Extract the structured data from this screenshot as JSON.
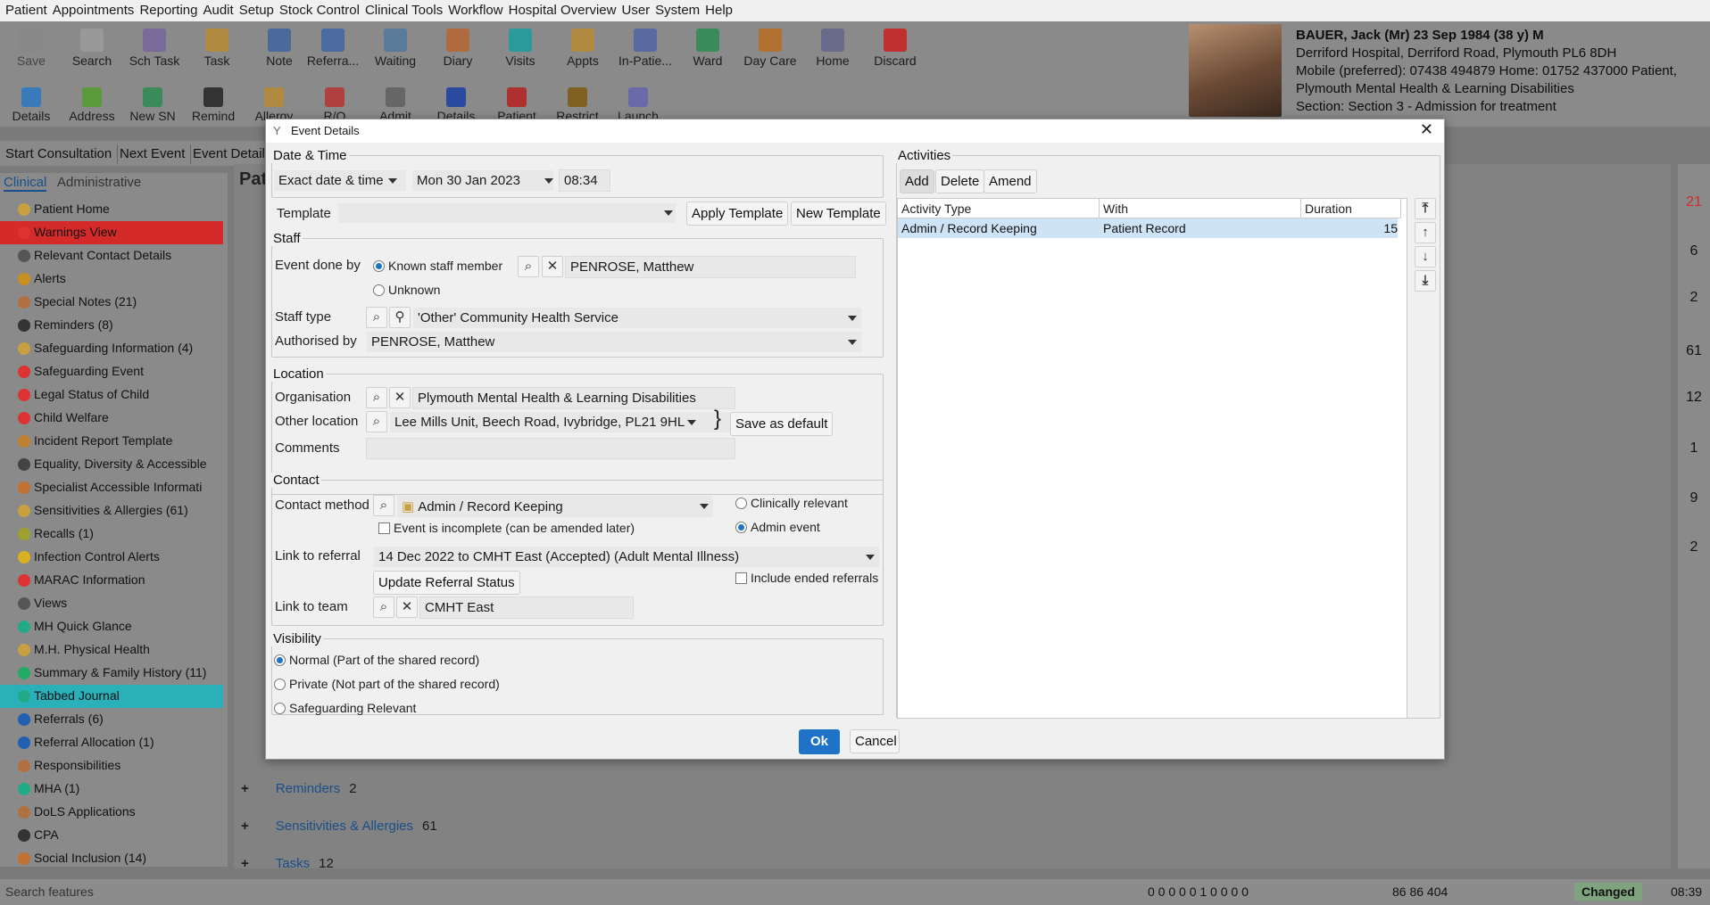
{
  "menu": [
    "Patient",
    "Appointments",
    "Reporting",
    "Audit",
    "Setup",
    "Stock Control",
    "Clinical Tools",
    "Workflow",
    "Hospital Overview",
    "User",
    "System",
    "Help"
  ],
  "toolbar_row1": [
    "Save",
    "Search",
    "Sch Task",
    "Task",
    "Note",
    "Referra...",
    "Waiting",
    "Diary",
    "Visits",
    "Appts",
    "In-Patie...",
    "Ward",
    "Day Care",
    "Home",
    "Discard"
  ],
  "toolbar_row2": [
    "Details",
    "Address",
    "New SN",
    "Remind",
    "Allergy",
    "R/O",
    "Admit",
    "Details",
    "Patient",
    "Restrict",
    "Launch"
  ],
  "patient": {
    "name_line": "BAUER, Jack (Mr) 23 Sep 1984 (38 y) M",
    "address": "Derriford Hospital, Derriford Road, Plymouth PL6 8DH",
    "phones": "Mobile (preferred): 07438 494879 Home: 01752 437000   Patient,",
    "org": "Plymouth Mental Health & Learning Disabilities",
    "section": "Section: Section 3 - Admission for treatment"
  },
  "nav_buttons": [
    "Start Consultation",
    "Next Event",
    "Event Details"
  ],
  "sidebar": {
    "tabs": [
      "Clinical",
      "Administrative"
    ],
    "items": [
      {
        "label": "Patient Home",
        "color": "#c8a040"
      },
      {
        "label": "Warnings View",
        "color": "#d33"
      },
      {
        "label": "Relevant Contact Details",
        "color": "#555"
      },
      {
        "label": "Alerts",
        "color": "#c89020"
      },
      {
        "label": "Special Notes (21)",
        "color": "#b07040"
      },
      {
        "label": "Reminders (8)",
        "color": "#333"
      },
      {
        "label": "Safeguarding Information (4)",
        "color": "#c8a040"
      },
      {
        "label": "Safeguarding Event",
        "color": "#d33"
      },
      {
        "label": "Legal Status of Child",
        "color": "#d33"
      },
      {
        "label": "Child Welfare",
        "color": "#d33"
      },
      {
        "label": "Incident Report Template",
        "color": "#c08030"
      },
      {
        "label": "Equality, Diversity & Accessible",
        "color": "#444"
      },
      {
        "label": "Specialist Accessible Informati",
        "color": "#c07030"
      },
      {
        "label": "Sensitivities & Allergies (61)",
        "color": "#c8a040"
      },
      {
        "label": "Recalls (1)",
        "color": "#a0a030"
      },
      {
        "label": "Infection Control Alerts",
        "color": "#d8b020"
      },
      {
        "label": "MARAC Information",
        "color": "#d33"
      },
      {
        "label": "Views",
        "color": "#555"
      },
      {
        "label": "MH Quick Glance",
        "color": "#2a8"
      },
      {
        "label": "M.H. Physical Health",
        "color": "#c8a040"
      },
      {
        "label": "Summary & Family History (11)",
        "color": "#2a6"
      },
      {
        "label": "Tabbed Journal",
        "color": "#2a8"
      },
      {
        "label": "Referrals (6)",
        "color": "#2060b0"
      },
      {
        "label": "Referral Allocation (1)",
        "color": "#2060b0"
      },
      {
        "label": "Responsibilities",
        "color": "#b07040"
      },
      {
        "label": "MHA (1)",
        "color": "#2a8"
      },
      {
        "label": "DoLS Applications",
        "color": "#b07040"
      },
      {
        "label": "CPA",
        "color": "#333"
      },
      {
        "label": "Social Inclusion (14)",
        "color": "#c07030"
      }
    ]
  },
  "journal_rows": [
    {
      "label": "Reminders",
      "count": "2"
    },
    {
      "label": "Sensitivities & Allergies",
      "count": "61"
    },
    {
      "label": "Tasks",
      "count": "12"
    }
  ],
  "right_badges": [
    "21",
    "6",
    "2",
    "61",
    "12",
    "1",
    "9",
    "2"
  ],
  "status": {
    "search_placeholder": "Search features",
    "counts": "0  0  0  0  0  1  0  0  0  0",
    "numbers": "86  86  404",
    "changed": "Changed",
    "time": "08:39"
  },
  "dialog": {
    "title": "Event Details",
    "datetime": {
      "group": "Date & Time",
      "mode": "Exact date & time",
      "date": "Mon 30 Jan 2023",
      "time": "08:34"
    },
    "template": {
      "label": "Template",
      "value": "",
      "apply": "Apply Template",
      "new": "New Template"
    },
    "staff": {
      "group": "Staff",
      "done_by_label": "Event done by",
      "known": "Known staff member",
      "unknown": "Unknown",
      "staff_name": "PENROSE, Matthew",
      "staff_type_label": "Staff type",
      "staff_type": "'Other' Community Health Service",
      "authorised_label": "Authorised by",
      "authorised": "PENROSE, Matthew"
    },
    "location": {
      "group": "Location",
      "org_label": "Organisation",
      "org": "Plymouth Mental Health & Learning Disabilities",
      "other_label": "Other location",
      "other": "Lee Mills Unit, Beech Road, Ivybridge, PL21 9HL",
      "save_default": "Save as default",
      "comments_label": "Comments",
      "comments": ""
    },
    "contact": {
      "group": "Contact",
      "method_label": "Contact method",
      "method": "Admin / Record Keeping",
      "clinically": "Clinically relevant",
      "admin": "Admin event",
      "incomplete": "Event is incomplete (can be amended later)",
      "referral_label": "Link to referral",
      "referral": "14 Dec 2022 to CMHT East (Accepted)  (Adult Mental Illness)",
      "update_status": "Update Referral Status",
      "include_ended": "Include ended referrals",
      "team_label": "Link to team",
      "team": "CMHT East"
    },
    "visibility": {
      "group": "Visibility",
      "normal": "Normal (Part of the shared record)",
      "private": "Private (Not part of the shared record)",
      "safeguarding": "Safeguarding Relevant"
    },
    "activities": {
      "group": "Activities",
      "add": "Add",
      "delete": "Delete",
      "amend": "Amend",
      "columns": [
        "Activity Type",
        "With",
        "Duration"
      ],
      "rows": [
        {
          "type": "Admin / Record Keeping",
          "with": "Patient Record",
          "duration": "15"
        }
      ]
    },
    "ok": "Ok",
    "cancel": "Cancel"
  }
}
